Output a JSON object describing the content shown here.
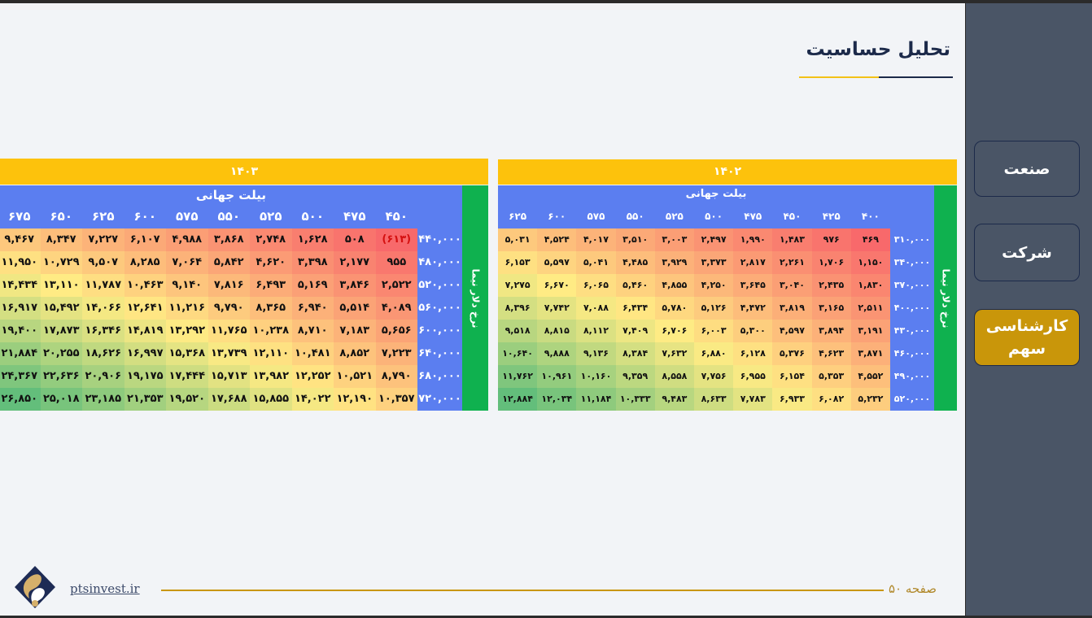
{
  "title": "تحلیل حساسیت",
  "sidebar": {
    "items": [
      {
        "label": "صنعت",
        "active": false
      },
      {
        "label": "شرکت",
        "active": false
      },
      {
        "label": "کارشناسی سهم",
        "active": true
      }
    ]
  },
  "table_1402": {
    "year": "۱۴۰۲",
    "col_title": "بیلت جهانی",
    "row_title": "نرخ دلار نیما",
    "cols": [
      "۴۰۰",
      "۴۲۵",
      "۴۵۰",
      "۴۷۵",
      "۵۰۰",
      "۵۲۵",
      "۵۵۰",
      "۵۷۵",
      "۶۰۰",
      "۶۲۵"
    ],
    "rows": [
      {
        "label": "۳۱۰,۰۰۰",
        "values": [
          "۴۶۹",
          "۹۷۶",
          "۱,۴۸۳",
          "۱,۹۹۰",
          "۲,۴۹۷",
          "۳,۰۰۳",
          "۳,۵۱۰",
          "۴,۰۱۷",
          "۴,۵۲۴",
          "۵,۰۳۱"
        ]
      },
      {
        "label": "۳۴۰,۰۰۰",
        "values": [
          "۱,۱۵۰",
          "۱,۷۰۶",
          "۲,۲۶۱",
          "۲,۸۱۷",
          "۳,۳۷۳",
          "۳,۹۲۹",
          "۴,۴۸۵",
          "۵,۰۴۱",
          "۵,۵۹۷",
          "۶,۱۵۳"
        ]
      },
      {
        "label": "۳۷۰,۰۰۰",
        "values": [
          "۱,۸۳۰",
          "۲,۴۳۵",
          "۳,۰۴۰",
          "۳,۶۴۵",
          "۴,۲۵۰",
          "۴,۸۵۵",
          "۵,۴۶۰",
          "۶,۰۶۵",
          "۶,۶۷۰",
          "۷,۲۷۵"
        ]
      },
      {
        "label": "۴۰۰,۰۰۰",
        "values": [
          "۲,۵۱۱",
          "۳,۱۶۵",
          "۳,۸۱۹",
          "۴,۴۷۲",
          "۵,۱۲۶",
          "۵,۷۸۰",
          "۶,۴۳۴",
          "۷,۰۸۸",
          "۷,۷۴۲",
          "۸,۳۹۶"
        ]
      },
      {
        "label": "۴۳۰,۰۰۰",
        "values": [
          "۳,۱۹۱",
          "۳,۸۹۴",
          "۴,۵۹۷",
          "۵,۳۰۰",
          "۶,۰۰۳",
          "۶,۷۰۶",
          "۷,۴۰۹",
          "۸,۱۱۲",
          "۸,۸۱۵",
          "۹,۵۱۸"
        ]
      },
      {
        "label": "۴۶۰,۰۰۰",
        "values": [
          "۳,۸۷۱",
          "۴,۶۲۳",
          "۵,۳۷۶",
          "۶,۱۲۸",
          "۶,۸۸۰",
          "۷,۶۳۲",
          "۸,۳۸۴",
          "۹,۱۳۶",
          "۹,۸۸۸",
          "۱۰,۶۴۰"
        ]
      },
      {
        "label": "۴۹۰,۰۰۰",
        "values": [
          "۴,۵۵۲",
          "۵,۳۵۳",
          "۶,۱۵۴",
          "۶,۹۵۵",
          "۷,۷۵۶",
          "۸,۵۵۸",
          "۹,۳۵۹",
          "۱۰,۱۶۰",
          "۱۰,۹۶۱",
          "۱۱,۷۶۲"
        ]
      },
      {
        "label": "۵۲۰,۰۰۰",
        "values": [
          "۵,۲۳۲",
          "۶,۰۸۲",
          "۶,۹۳۳",
          "۷,۷۸۳",
          "۸,۶۳۳",
          "۹,۴۸۳",
          "۱۰,۳۳۳",
          "۱۱,۱۸۴",
          "۱۲,۰۳۴",
          "۱۲,۸۸۴"
        ]
      }
    ]
  },
  "table_1403": {
    "year": "۱۴۰۳",
    "col_title": "بیلت جهانی",
    "row_title": "نرخ دلار نیما",
    "cols": [
      "۴۵۰",
      "۴۷۵",
      "۵۰۰",
      "۵۲۵",
      "۵۵۰",
      "۵۷۵",
      "۶۰۰",
      "۶۲۵",
      "۶۵۰",
      "۶۷۵"
    ],
    "rows": [
      {
        "label": "۴۴۰,۰۰۰",
        "values": [
          "(۶۱۳)",
          "۵۰۸",
          "۱,۶۲۸",
          "۲,۷۴۸",
          "۳,۸۶۸",
          "۴,۹۸۸",
          "۶,۱۰۷",
          "۷,۲۲۷",
          "۸,۳۴۷",
          "۹,۴۶۷"
        ]
      },
      {
        "label": "۴۸۰,۰۰۰",
        "values": [
          "۹۵۵",
          "۲,۱۷۷",
          "۳,۳۹۸",
          "۴,۶۲۰",
          "۵,۸۴۲",
          "۷,۰۶۴",
          "۸,۲۸۵",
          "۹,۵۰۷",
          "۱۰,۷۲۹",
          "۱۱,۹۵۰"
        ]
      },
      {
        "label": "۵۲۰,۰۰۰",
        "values": [
          "۲,۵۲۲",
          "۳,۸۴۶",
          "۵,۱۶۹",
          "۶,۴۹۳",
          "۷,۸۱۶",
          "۹,۱۴۰",
          "۱۰,۴۶۳",
          "۱۱,۷۸۷",
          "۱۳,۱۱۰",
          "۱۴,۴۳۴"
        ]
      },
      {
        "label": "۵۶۰,۰۰۰",
        "values": [
          "۴,۰۸۹",
          "۵,۵۱۴",
          "۶,۹۴۰",
          "۸,۳۶۵",
          "۹,۷۹۰",
          "۱۱,۲۱۶",
          "۱۲,۶۴۱",
          "۱۴,۰۶۶",
          "۱۵,۴۹۲",
          "۱۶,۹۱۷"
        ]
      },
      {
        "label": "۶۰۰,۰۰۰",
        "values": [
          "۵,۶۵۶",
          "۷,۱۸۳",
          "۸,۷۱۰",
          "۱۰,۲۳۸",
          "۱۱,۷۶۵",
          "۱۳,۲۹۲",
          "۱۴,۸۱۹",
          "۱۶,۳۴۶",
          "۱۷,۸۷۳",
          "۱۹,۴۰۰"
        ]
      },
      {
        "label": "۶۴۰,۰۰۰",
        "values": [
          "۷,۲۲۳",
          "۸,۸۵۲",
          "۱۰,۴۸۱",
          "۱۲,۱۱۰",
          "۱۳,۷۳۹",
          "۱۵,۳۶۸",
          "۱۶,۹۹۷",
          "۱۸,۶۲۶",
          "۲۰,۲۵۵",
          "۲۱,۸۸۴"
        ]
      },
      {
        "label": "۶۸۰,۰۰۰",
        "values": [
          "۸,۷۹۰",
          "۱۰,۵۲۱",
          "۱۲,۲۵۲",
          "۱۳,۹۸۲",
          "۱۵,۷۱۳",
          "۱۷,۴۴۴",
          "۱۹,۱۷۵",
          "۲۰,۹۰۶",
          "۲۲,۶۳۶",
          "۲۴,۳۶۷"
        ]
      },
      {
        "label": "۷۲۰,۰۰۰",
        "values": [
          "۱۰,۳۵۷",
          "۱۲,۱۹۰",
          "۱۴,۰۲۲",
          "۱۵,۸۵۵",
          "۱۷,۶۸۸",
          "۱۹,۵۲۰",
          "۲۱,۳۵۳",
          "۲۳,۱۸۵",
          "۲۵,۰۱۸",
          "۲۶,۸۵۰"
        ]
      }
    ]
  },
  "footer": {
    "page_label": "صفحه ۵۰",
    "site": "ptsinvest.ir"
  },
  "colors": {
    "low": "#f8696b",
    "mid": "#ffeb84",
    "high": "#63be7b",
    "blue": "#5b7ef0",
    "gold": "#fdc20c",
    "green": "#0fb14f",
    "sidebar": "#4a5566",
    "accent": "#c9960a"
  }
}
